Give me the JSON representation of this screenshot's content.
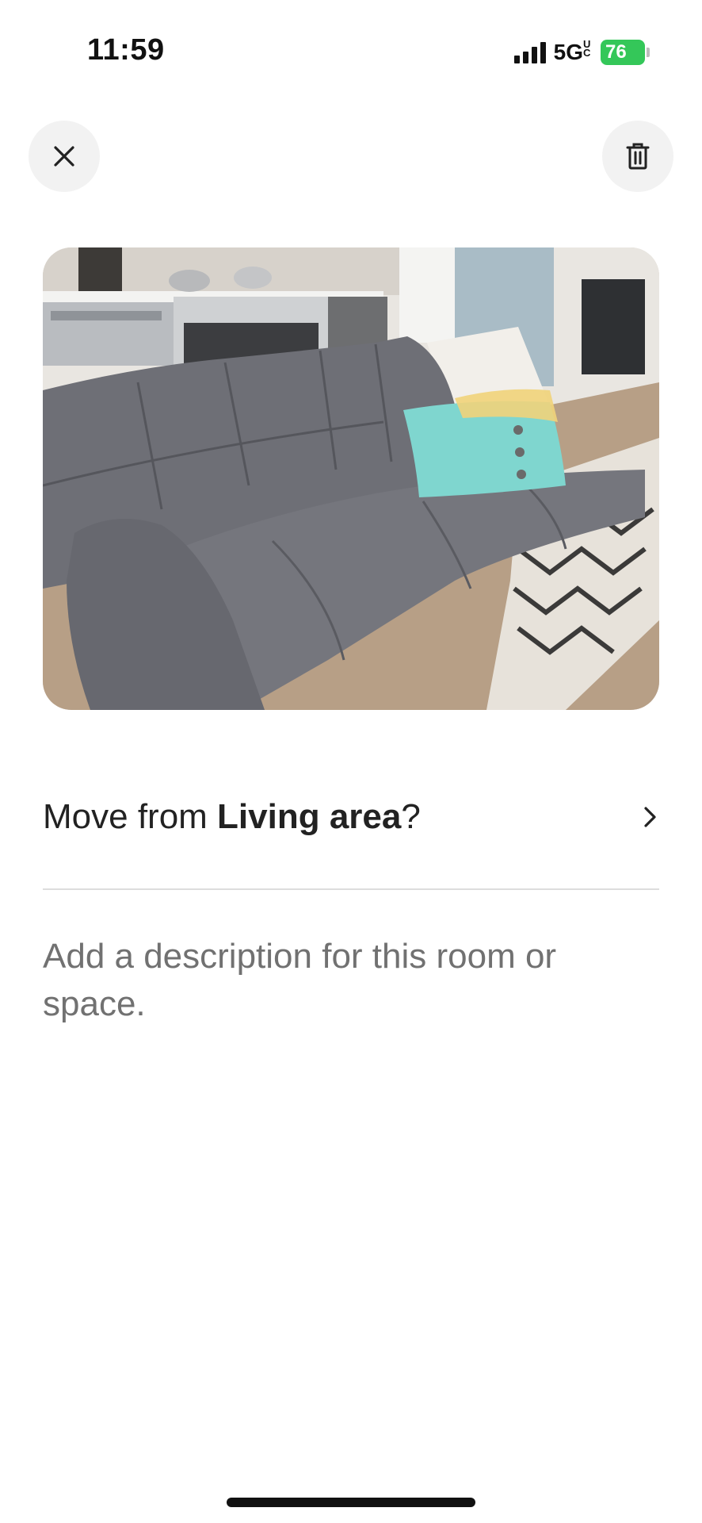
{
  "status_bar": {
    "time": "11:59",
    "network": "5G",
    "network_sub": "UC",
    "battery": "76",
    "battery_color": "#34c759"
  },
  "header": {
    "close_icon": "close-icon",
    "delete_icon": "trash-icon"
  },
  "photo": {
    "subject": "living-room-photo"
  },
  "move": {
    "prefix": "Move from ",
    "room": "Living area",
    "suffix": "?"
  },
  "description": {
    "placeholder": "Add a description for this room or space."
  }
}
